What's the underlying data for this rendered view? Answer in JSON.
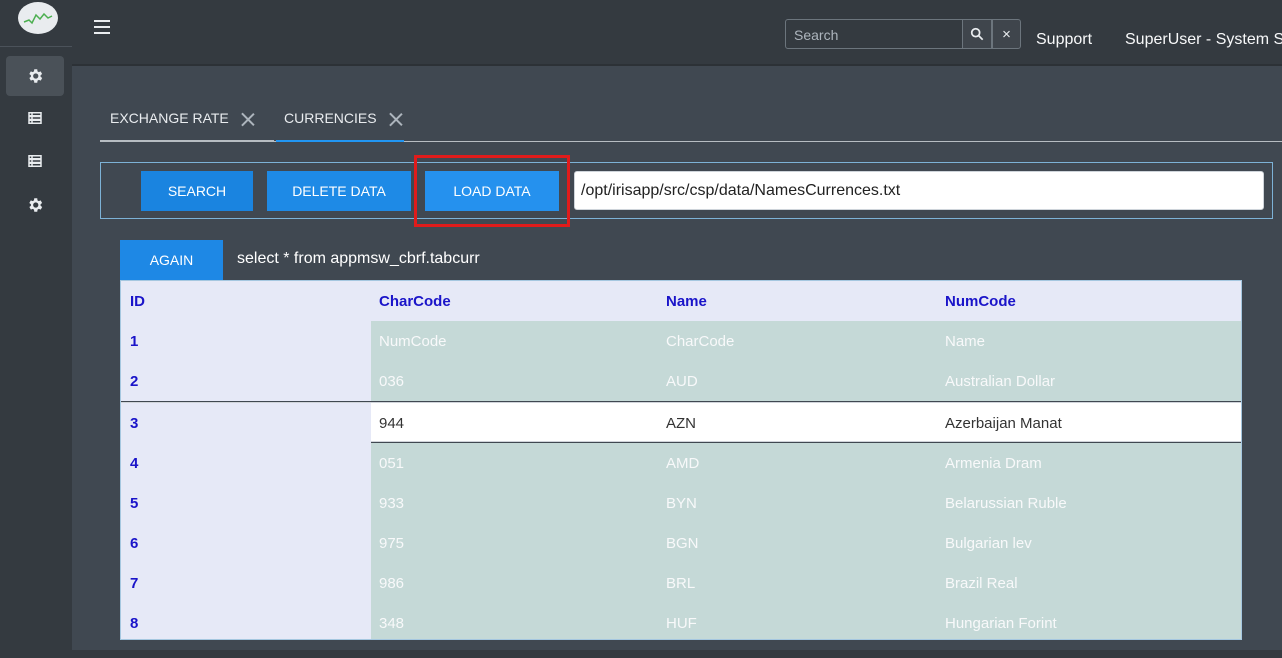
{
  "header": {
    "search_placeholder": "Search",
    "clear_label": "×",
    "support_label": "Support",
    "user_label": "SuperUser - System Su"
  },
  "sidebar": {
    "items": [
      {
        "icon": "gear-icon",
        "active": true
      },
      {
        "icon": "list-icon",
        "active": false
      },
      {
        "icon": "list-icon",
        "active": false
      },
      {
        "icon": "gear-icon",
        "active": false
      }
    ]
  },
  "tabs": [
    {
      "label": "EXCHANGE RATE",
      "active": false
    },
    {
      "label": "CURRENCIES",
      "active": true
    }
  ],
  "toolbar": {
    "search_label": "SEARCH",
    "delete_label": "DELETE DATA",
    "load_label": "LOAD DATA",
    "path_value": "/opt/irisapp/src/csp/data/NamesCurrences.txt"
  },
  "query": {
    "again_label": "AGAIN",
    "sql": "select * from appmsw_cbrf.tabcurr"
  },
  "table": {
    "headers": [
      "ID",
      "CharCode",
      "Name",
      "NumCode"
    ],
    "rows": [
      [
        "1",
        "NumCode",
        "CharCode",
        "Name"
      ],
      [
        "2",
        "036",
        "AUD",
        "Australian Dollar"
      ],
      [
        "3",
        "944",
        "AZN",
        "Azerbaijan Manat"
      ],
      [
        "4",
        "051",
        "AMD",
        "Armenia Dram"
      ],
      [
        "5",
        "933",
        "BYN",
        "Belarussian Ruble"
      ],
      [
        "6",
        "975",
        "BGN",
        "Bulgarian lev"
      ],
      [
        "7",
        "986",
        "BRL",
        "Brazil Real"
      ],
      [
        "8",
        "348",
        "HUF",
        "Hungarian Forint"
      ]
    ],
    "selected_row": 2
  },
  "colors": {
    "accent": "#1e88e5",
    "highlight": "#e01b1b",
    "header_text": "#1a14c9",
    "row_bg": "#c5d9d7"
  }
}
